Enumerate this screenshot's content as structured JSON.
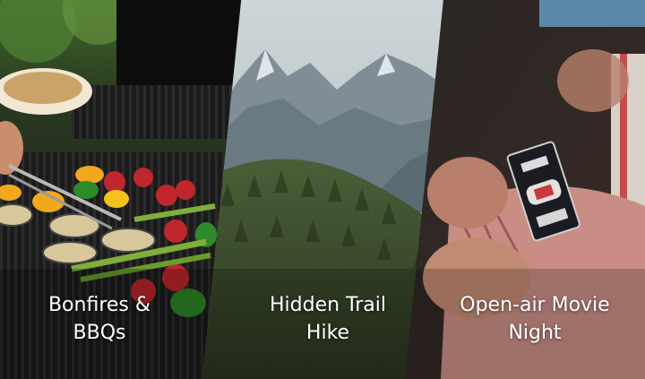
{
  "panels": [
    {
      "line1": "Bonfires &",
      "line2": "BBQs",
      "icon": "grill-photo"
    },
    {
      "line1": "Hidden Trail",
      "line2": "Hike",
      "icon": "mountain-forest-photo"
    },
    {
      "line1": "Open-air Movie",
      "line2": "Night",
      "icon": "movie-ticket-photo"
    }
  ],
  "colors": {
    "divider": "#ffffff",
    "caption_text": "#ffffff"
  }
}
